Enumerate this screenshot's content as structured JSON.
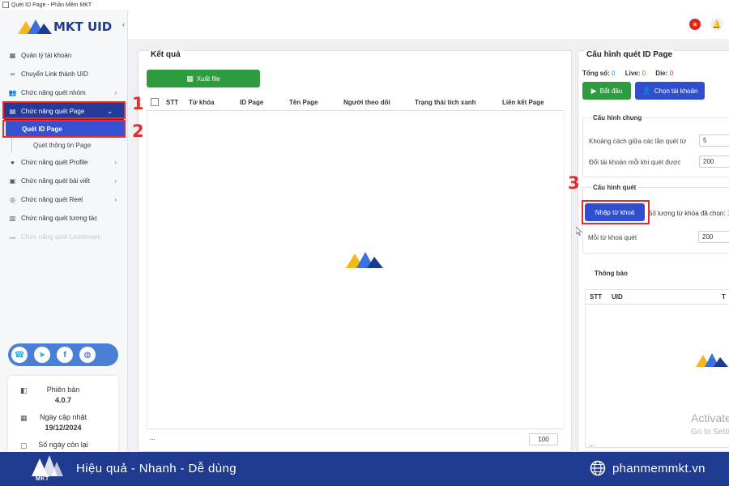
{
  "window": {
    "title": "Quét ID Page - Phần Mềm MKT"
  },
  "brand": {
    "name": "MKT UID"
  },
  "sidebar": {
    "items": [
      {
        "label": "Quản lý tài khoản",
        "icon": "grid-icon"
      },
      {
        "label": "Chuyển Link thành UID",
        "icon": "link-icon"
      },
      {
        "label": "Chức năng quét nhóm",
        "icon": "users-icon"
      },
      {
        "label": "Chức năng quét Page",
        "icon": "page-icon"
      },
      {
        "label": "Chức năng quét Profile",
        "icon": "profile-icon"
      },
      {
        "label": "Chức năng quét bài viết",
        "icon": "post-icon"
      },
      {
        "label": "Chức năng quét Reel",
        "icon": "reel-icon"
      },
      {
        "label": "Chức năng quét tương tác",
        "icon": "interaction-icon"
      },
      {
        "label": "Chức năng quét Livestream",
        "icon": "livestream-icon"
      }
    ],
    "sub_items": [
      "Quét ID Page",
      "Quét thông tin Page"
    ],
    "info": {
      "version_label": "Phiên bản",
      "version_value": "4.0.7",
      "updated_label": "Ngày cập nhật",
      "updated_value": "19/12/2024",
      "days_label": "Số ngày còn lại"
    }
  },
  "results": {
    "title": "Kết quả",
    "export_label": "Xuất file",
    "columns": [
      "STT",
      "Từ khóa",
      "ID Page",
      "Tên Page",
      "Người theo dõi",
      "Trạng thái tích xanh",
      "Liên kết Page"
    ],
    "footer_dots": "...",
    "page_size": "100"
  },
  "config": {
    "title": "Cấu hình quét ID Page",
    "stats": {
      "total_label": "Tổng số:",
      "total": "0",
      "live_label": "Live:",
      "live": "0",
      "die_label": "Die:",
      "die": "0"
    },
    "start_label": "Bắt đầu",
    "choose_label": "Chọn tài khoản",
    "general": {
      "title": "Cấu hình chung",
      "delay_label": "Khoảng cách giữa các lần quét từ",
      "delay_value": "5",
      "switch_label": "Đổi tài khoản mỗi khi quét được",
      "switch_value": "200"
    },
    "scan": {
      "title": "Cấu hình quét",
      "import_label": "Nhập từ khoá",
      "count_label": "Số lượng từ khóa đã chọn:",
      "count_value": "1",
      "per_label": "Mỗi từ khoá quét",
      "per_value": "200"
    },
    "notify": {
      "title": "Thông báo",
      "columns": [
        "STT",
        "UID",
        "T"
      ],
      "dots": "...",
      "watermark1": "Activate",
      "watermark2": "Go to Setti"
    }
  },
  "annotations": [
    "1",
    "2",
    "3"
  ],
  "banner": {
    "logo_text": "MKT",
    "slogan": "Hiệu quả - Nhanh - Dễ dùng",
    "site": "phanmemmkt.vn"
  },
  "colors": {
    "primary": "#243b99",
    "green": "#2e9b3e",
    "blue_btn": "#2f4fcf",
    "highlight": "#e82a2a",
    "banner": "#1f3a8e"
  }
}
